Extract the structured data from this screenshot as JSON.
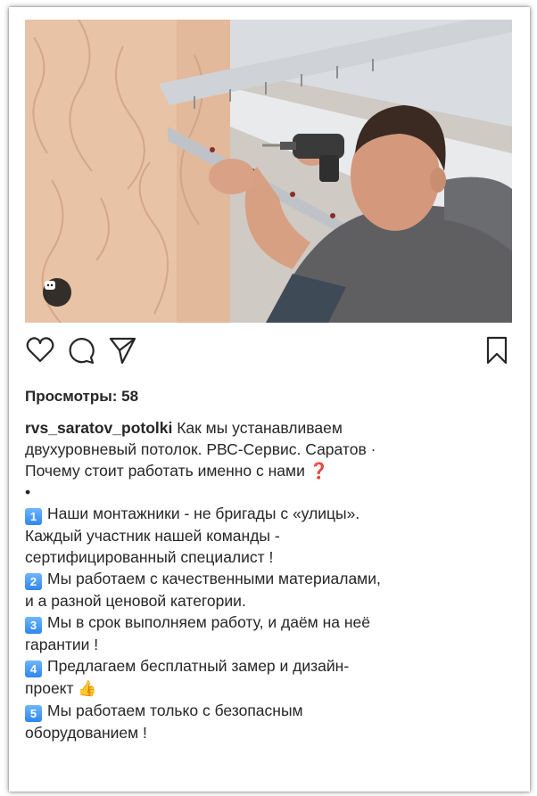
{
  "post": {
    "media": {
      "type": "video",
      "badge_icon": "video-camera-icon"
    },
    "actions": {
      "like_icon": "heart-icon",
      "comment_icon": "comment-icon",
      "share_icon": "paper-plane-icon",
      "save_icon": "bookmark-icon"
    },
    "views": "Просмотры: 58",
    "username": "rvs_saratov_potolki",
    "caption_lines": [
      " Как мы устанавливаем",
      "двухуровневый потолок. РВС-Сервис. Саратов ·",
      "Почему стоит работать именно с нами ",
      "•"
    ],
    "question_mark": "❓",
    "points": [
      {
        "num": "1",
        "lines": [
          "Наши монтажники - не бригады с «улицы».",
          "Каждый участник нашей команды -",
          "сертифицированный специалист !"
        ]
      },
      {
        "num": "2",
        "lines": [
          "Мы работаем с качественными материалами,",
          "и а разной ценовой категории."
        ]
      },
      {
        "num": "3",
        "lines": [
          "Мы в срок выполняем работу, и даём на неё",
          "гарантии !"
        ]
      },
      {
        "num": "4",
        "lines": [
          "Предлагаем бесплатный замер и дизайн-",
          "проект "
        ]
      },
      {
        "num": "5",
        "lines": [
          "Мы работаем только с безопасным",
          "оборудованием !"
        ]
      }
    ],
    "thumbs_up": "👍"
  },
  "colors": {
    "text": "#262626",
    "number_badge": "#3b8ff2",
    "question_red": "#e0241c"
  }
}
